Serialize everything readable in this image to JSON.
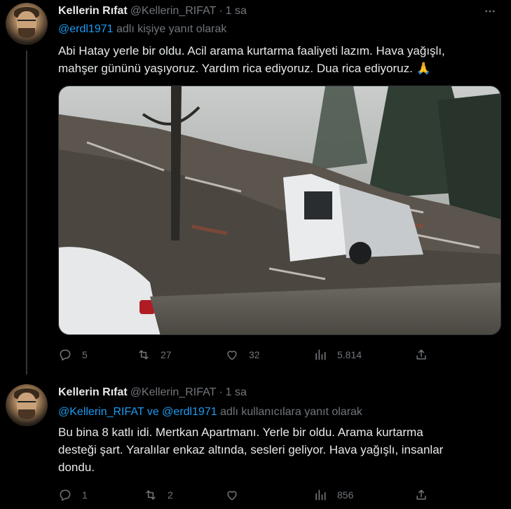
{
  "tweets": [
    {
      "author_name": "Kellerin Rıfat",
      "author_handle": "@Kellerin_RIFAT",
      "dot": "·",
      "time": "1 sa",
      "reply_mentions": [
        "@erdl1971"
      ],
      "reply_sep": "",
      "reply_suffix": "adlı kişiye yanıt olarak",
      "text_line1": "Abi Hatay yerle bir oldu. Acil arama kurtarma faaliyeti lazım. Hava yağışlı,",
      "text_line2": "mahşer gününü yaşıyoruz. Yardım rica ediyoruz. Dua rica ediyoruz.",
      "emoji": "🙏",
      "stats": {
        "replies": "5",
        "retweets": "27",
        "likes": "32",
        "views": "5.814"
      }
    },
    {
      "author_name": "Kellerin Rıfat",
      "author_handle": "@Kellerin_RIFAT",
      "dot": "·",
      "time": "1 sa",
      "reply_mentions": [
        "@Kellerin_RIFAT",
        "@erdl1971"
      ],
      "reply_sep": "ve",
      "reply_suffix": "adlı kullanıcılara yanıt olarak",
      "text_line1": "Bu bina 8 katlı idi. Mertkan Apartmanı. Yerle bir oldu. Arama kurtarma",
      "text_line2": "desteği şart. Yaralılar enkaz altında, sesleri geliyor. Hava yağışlı, insanlar",
      "text_line3": "dondu.",
      "stats": {
        "replies": "1",
        "retweets": "2",
        "likes": "",
        "views": "856"
      }
    }
  ],
  "icons": {
    "reply": "reply-icon",
    "retweet": "retweet-icon",
    "like": "heart-icon",
    "views": "views-icon",
    "share": "share-icon",
    "more": "more-icon"
  },
  "colors": {
    "background": "#000000",
    "text": "#e7e9ea",
    "muted": "#71767b",
    "link": "#1d9bf0"
  }
}
